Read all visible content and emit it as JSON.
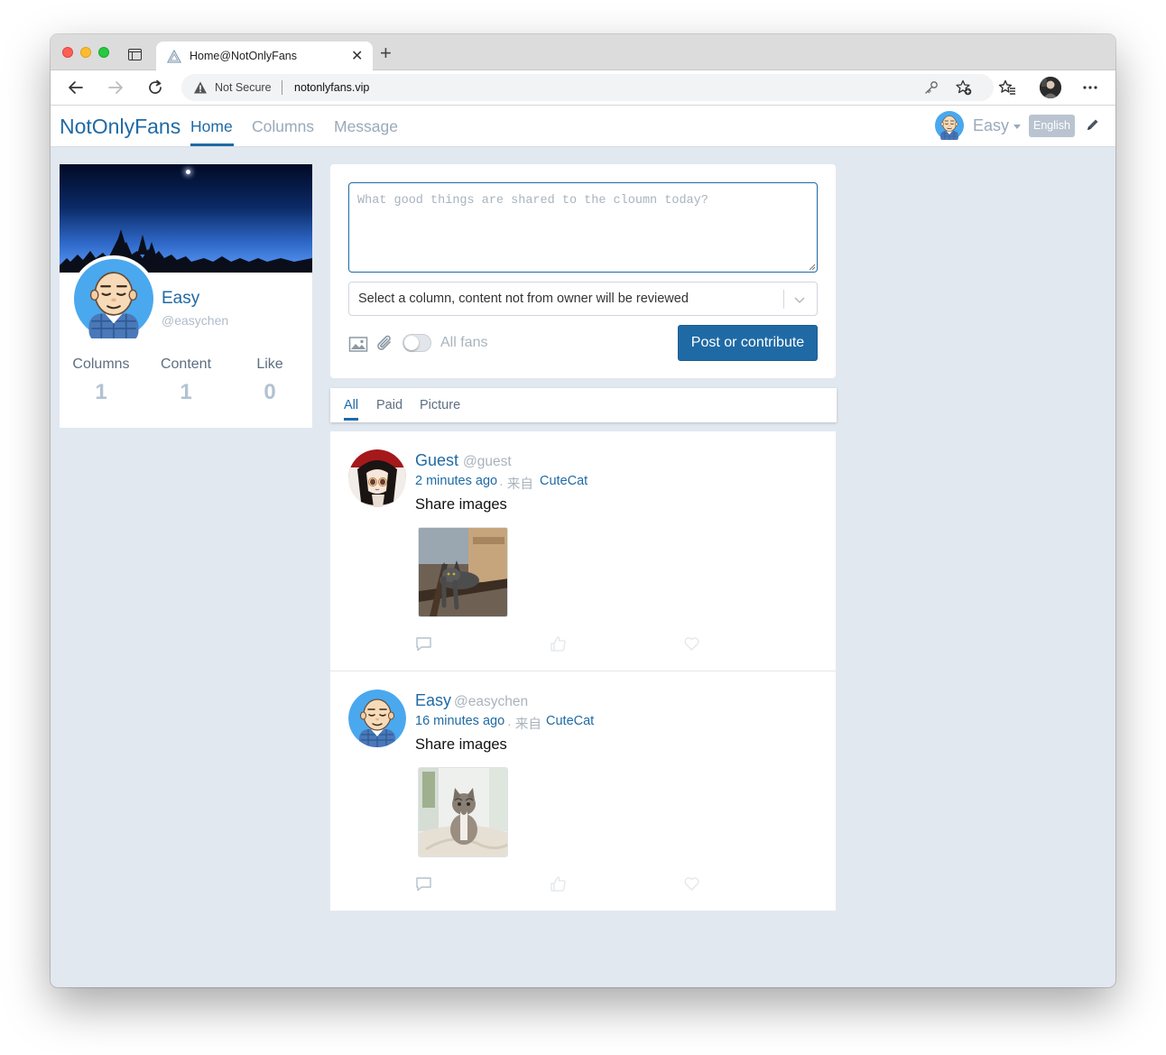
{
  "browser": {
    "tab_title": "Home@NotOnlyFans",
    "not_secure": "Not Secure",
    "url": "notonlyfans.vip"
  },
  "site_nav": {
    "brand": "NotOnlyFans",
    "links": [
      "Home",
      "Columns",
      "Message"
    ],
    "user_name": "Easy",
    "language": "English"
  },
  "profile": {
    "name": "Easy",
    "handle": "@easychen",
    "stats": [
      {
        "label": "Columns",
        "value": "1"
      },
      {
        "label": "Content",
        "value": "1"
      },
      {
        "label": "Like",
        "value": "0"
      }
    ]
  },
  "composer": {
    "placeholder": "What good things are shared to the cloumn today?",
    "select_placeholder": "Select a column, content not from owner will be reviewed",
    "audience_label": "All fans",
    "submit_label": "Post or contribute"
  },
  "filters": [
    "All",
    "Paid",
    "Picture"
  ],
  "posts": [
    {
      "author": "Guest",
      "handle": "@guest",
      "time": "2 minutes ago",
      "from_label": "· 来自",
      "column": "CuteCat",
      "text": "Share images"
    },
    {
      "author": "Easy",
      "handle": "@easychen",
      "time": "16 minutes ago",
      "from_label": "· 来自",
      "column": "CuteCat",
      "text": "Share images"
    }
  ],
  "colors": {
    "accent": "#1f6aa5",
    "muted": "#9aa9b9",
    "page_background": "#e2e8f0"
  }
}
